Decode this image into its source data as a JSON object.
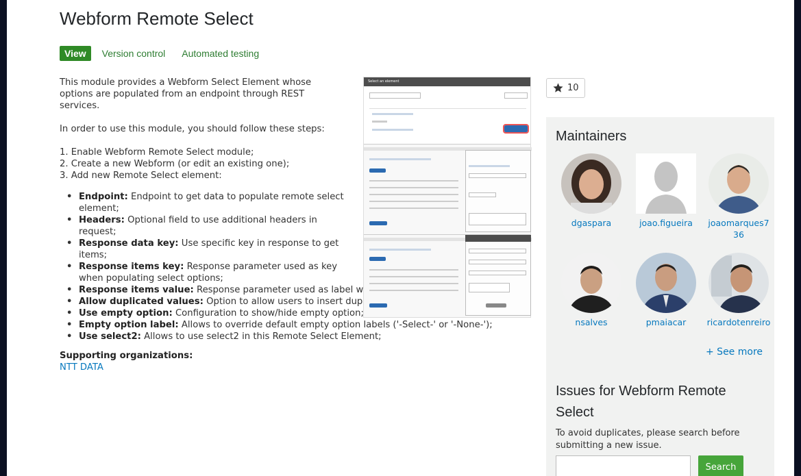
{
  "page_title": "Webform Remote Select",
  "tabs": [
    {
      "label": "View"
    },
    {
      "label": "Version control"
    },
    {
      "label": "Automated testing"
    }
  ],
  "description": "This module provides a Webform Select Element whose options are populated from an endpoint through REST services.",
  "intro": "In order to use this module, you should follow these steps:",
  "steps": [
    "1. Enable Webform Remote Select module;",
    "2. Create a new Webform (or edit an existing one);",
    "3. Add new Remote Select element:"
  ],
  "params": [
    {
      "key": "Endpoint:",
      "text": "Endpoint to get data to populate remote select element;"
    },
    {
      "key": "Headers:",
      "text": "Optional field to use additional headers in request;"
    },
    {
      "key": "Response data key:",
      "text": "Use specific key in response to get items;"
    },
    {
      "key": "Response items key:",
      "text": "Response parameter used as key when populating select options;"
    },
    {
      "key": "Response items value:",
      "text": "Response parameter used as label when populating select options;"
    },
    {
      "key": "Allow duplicated values:",
      "text": "Option to allow users to insert duplicated values in multiple elements;"
    },
    {
      "key": "Use empty option:",
      "text": "Configuration to show/hide empty option;"
    },
    {
      "key": "Empty option label:",
      "text": "Allows to override default empty option labels ('-Select-' or '-None-');"
    },
    {
      "key": "Use select2:",
      "text": "Allows to use select2 in this Remote Select Element;"
    }
  ],
  "orgs": {
    "heading": "Supporting organizations:",
    "items": [
      "NTT DATA"
    ]
  },
  "screenshot": {
    "header": "Select an element"
  },
  "star_count": "10",
  "maintainers": {
    "title": "Maintainers",
    "items": [
      {
        "name": "dgaspara"
      },
      {
        "name": "joao.figueira"
      },
      {
        "name": "joaomarques736"
      },
      {
        "name": "nsalves"
      },
      {
        "name": "pmaiacar"
      },
      {
        "name": "ricardotenreiro"
      }
    ],
    "see_more": "+ See more"
  },
  "issues": {
    "title": "Issues for Webform Remote Select",
    "text": "To avoid duplicates, please search before submitting a new issue.",
    "search_label": "Search"
  },
  "colors": {
    "brand_green": "#2f8a26",
    "link_blue": "#0678be",
    "sidebar_bg": "#f1f2f1"
  }
}
